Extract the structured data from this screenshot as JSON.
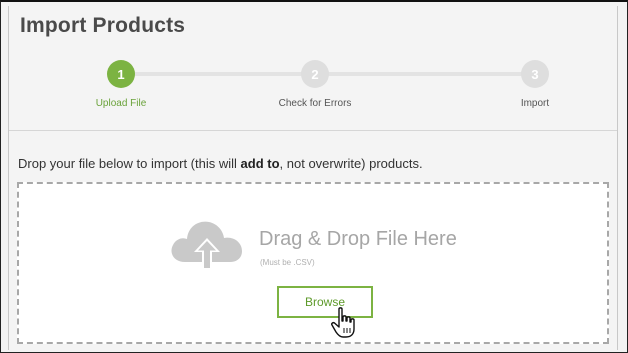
{
  "page": {
    "title": "Import Products"
  },
  "stepper": {
    "steps": [
      {
        "number": "1",
        "label": "Upload File",
        "state": "active"
      },
      {
        "number": "2",
        "label": "Check for Errors",
        "state": "pending"
      },
      {
        "number": "3",
        "label": "Import",
        "state": "pending"
      }
    ]
  },
  "instructions": {
    "prefix": "Drop your file below to import (this will ",
    "emphasis": "add to",
    "suffix": ", not overwrite) products."
  },
  "dropzone": {
    "title": "Drag & Drop File Here",
    "subtitle": "(Must be .CSV)",
    "browse_label": "Browse",
    "icon": "cloud-upload-icon"
  },
  "colors": {
    "accent": "#7cb342",
    "inactive_step": "#dedede",
    "title_text": "#4a4a4a"
  }
}
